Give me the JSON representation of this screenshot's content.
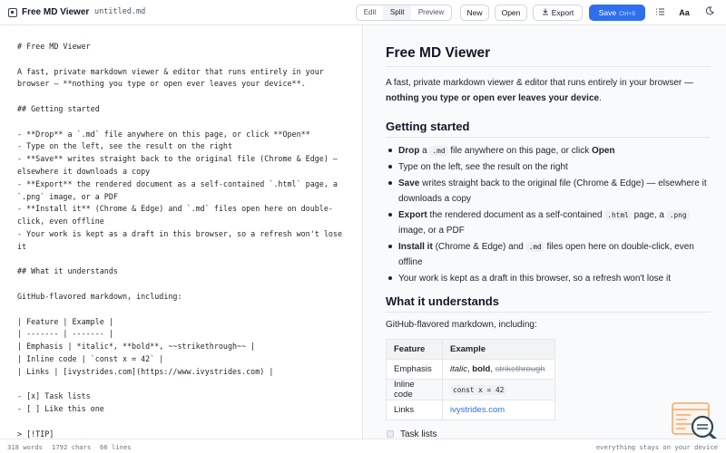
{
  "app": {
    "title": "Free MD Viewer",
    "file_name": "untitled.md"
  },
  "toolbar": {
    "modes": [
      "Edit",
      "Split",
      "Preview"
    ],
    "active_mode": "Split",
    "new_label": "New",
    "open_label": "Open",
    "export_label": "Export",
    "save_label": "Save",
    "save_shortcut": "Ctrl+S",
    "font_button_label": "Aa"
  },
  "editor": {
    "lines": [
      "# Free MD Viewer",
      "",
      "A fast, private markdown viewer & editor that runs entirely in your",
      "browser — **nothing you type or open ever leaves your device**.",
      "",
      "## Getting started",
      "",
      "- **Drop** a `.md` file anywhere on this page, or click **Open**",
      "- Type on the left, see the result on the right",
      "- **Save** writes straight back to the original file (Chrome & Edge) —",
      "elsewhere it downloads a copy",
      "- **Export** the rendered document as a self-contained `.html` page, a",
      "`.png` image, or a PDF",
      "- **Install it** (Chrome & Edge) and `.md` files open here on double-",
      "click, even offline",
      "- Your work is kept as a draft in this browser, so a refresh won't lose",
      "it",
      "",
      "## What it understands",
      "",
      "GitHub-flavored markdown, including:",
      "",
      "| Feature | Example |",
      "| ------- | ------- |",
      "| Emphasis | *italic*, **bold**, ~~strikethrough~~ |",
      "| Inline code | `const x = 42` |",
      "| Links | [ivystrides.com](https://www.ivystrides.com) |",
      "",
      "- [x] Task lists",
      "- [ ] Like this one",
      "",
      "> [!TIP]"
    ]
  },
  "preview": {
    "title": "Free MD Viewer",
    "intro_text": "A fast, private markdown viewer & editor that runs entirely in your browser —",
    "intro_bold": "nothing you type or open ever leaves your device",
    "intro_end": ".",
    "section1_heading": "Getting started",
    "bullets": [
      {
        "bold": "Drop",
        "pre": " a ",
        "code": ".md",
        "post": " file anywhere on this page, or click ",
        "bold2": "Open"
      },
      {
        "text": "Type on the left, see the result on the right"
      },
      {
        "bold": "Save",
        "post": " writes straight back to the original file (Chrome & Edge) — elsewhere it downloads a copy"
      },
      {
        "bold": "Export",
        "post": " the rendered document as a self-contained ",
        "code": ".html",
        "post2": " page, a ",
        "code2": ".png",
        "post3": " image, or a PDF"
      },
      {
        "bold": "Install it",
        "post": " (Chrome & Edge) and ",
        "code": ".md",
        "post2": " files open here on double-click, even offline"
      },
      {
        "text": "Your work is kept as a draft in this browser, so a refresh won't lose it"
      }
    ],
    "section2_heading": "What it understands",
    "section2_intro": "GitHub-flavored markdown, including:",
    "table": {
      "headers": [
        "Feature",
        "Example"
      ],
      "rows": [
        {
          "feature": "Emphasis",
          "italic": "italic",
          "sep1": ", ",
          "bold": "bold",
          "sep2": ", ",
          "strike": "strikethrough"
        },
        {
          "feature": "Inline code",
          "code": "const x = 42"
        },
        {
          "feature": "Links",
          "link": "ivystrides.com"
        }
      ]
    },
    "task_item": "Task lists"
  },
  "status": {
    "words": "318 words",
    "chars": "1792 chars",
    "lines": "66 lines",
    "privacy_note": "everything stays on your device"
  },
  "colors": {
    "accent": "#2f6fed",
    "preview_bg": "#f9fafb",
    "link": "#2f6fed"
  },
  "icons": [
    "logo-icon",
    "download-icon",
    "list-icon",
    "moon-icon",
    "search-doc-icon"
  ]
}
